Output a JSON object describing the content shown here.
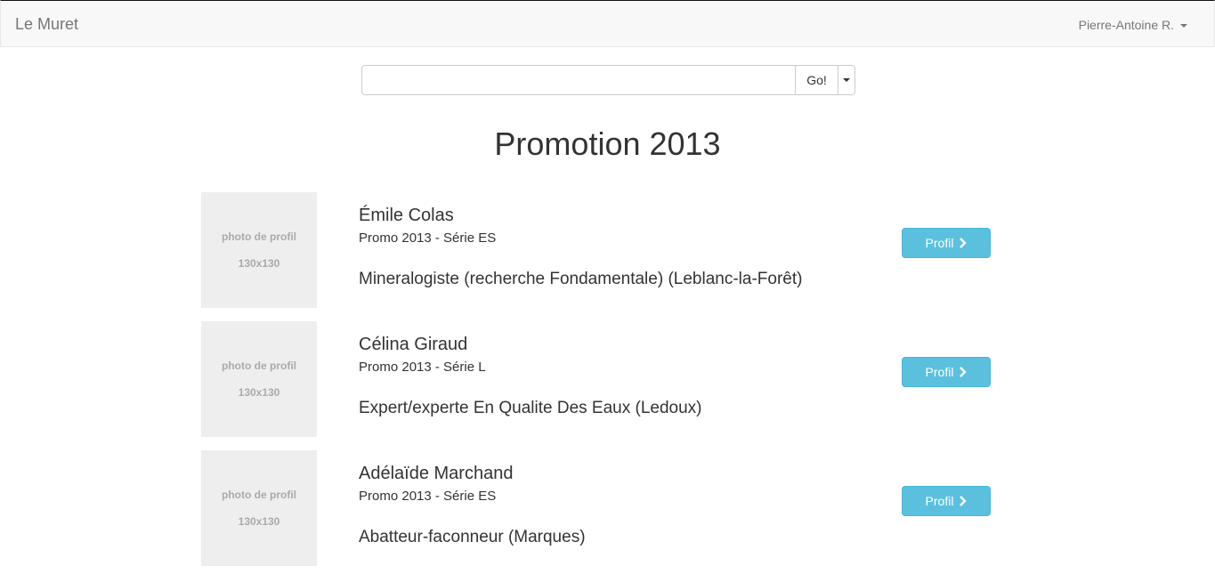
{
  "navbar": {
    "brand": "Le Muret",
    "user": "Pierre-Antoine R."
  },
  "search": {
    "value": "",
    "placeholder": "",
    "go_label": "Go!"
  },
  "page": {
    "title": "Promotion 2013"
  },
  "people": [
    {
      "photo_label": "photo de profil",
      "photo_size": "130x130",
      "name": "Émile Colas",
      "promo": "Promo 2013 - Série ES",
      "job": "Mineralogiste (recherche Fondamentale) (Leblanc-la-Forêt)",
      "button": "Profil"
    },
    {
      "photo_label": "photo de profil",
      "photo_size": "130x130",
      "name": "Célina Giraud",
      "promo": "Promo 2013 - Série L",
      "job": "Expert/experte En Qualite Des Eaux (Ledoux)",
      "button": "Profil"
    },
    {
      "photo_label": "photo de profil",
      "photo_size": "130x130",
      "name": "Adélaïde Marchand",
      "promo": "Promo 2013 - Série ES",
      "job": "Abatteur-faconneur (Marques)",
      "button": "Profil"
    }
  ],
  "colors": {
    "info_button": "#5bc0de",
    "navbar_bg": "#f8f8f8",
    "photo_bg": "#eeeeee"
  }
}
